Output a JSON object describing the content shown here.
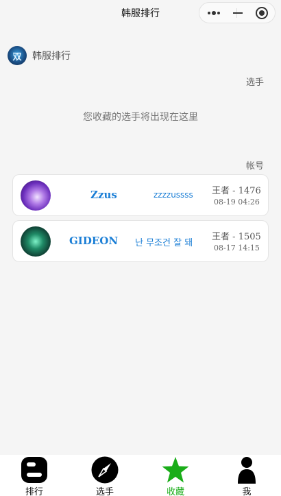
{
  "nav": {
    "title": "韩服排行"
  },
  "brand": {
    "logo_text": "双",
    "name": "韩服排行"
  },
  "sections": {
    "players_label": "选手",
    "empty_tip": "您收藏的选手将出现在这里",
    "accounts_label": "帐号"
  },
  "accounts": [
    {
      "name": "Zzus",
      "alias": "zzzzussss",
      "tier": "王者",
      "score": "1476",
      "time": "08-19 04:26",
      "avatar": "purple-creature-avatar"
    },
    {
      "name": "GIDEON",
      "alias": "난 무조건 잘 돼",
      "tier": "王者",
      "score": "1505",
      "time": "08-17 14:15",
      "avatar": "green-wolf-avatar"
    }
  ],
  "tabbar": {
    "items": [
      {
        "label": "排行",
        "icon": "blogger-icon"
      },
      {
        "label": "选手",
        "icon": "compass-icon"
      },
      {
        "label": "收藏",
        "icon": "star-icon"
      },
      {
        "label": "我",
        "icon": "user-icon"
      }
    ],
    "active": "收藏",
    "active_color": "#1aad19"
  },
  "colors": {
    "link": "#1c7fd6",
    "background": "#f5f5f5"
  }
}
